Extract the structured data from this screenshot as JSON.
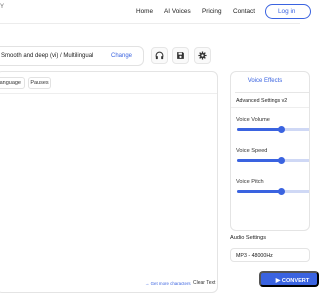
{
  "header": {
    "logo_fragment": "Y",
    "nav": [
      "Home",
      "AI Voices",
      "Pricing",
      "Contact"
    ],
    "login_label": "Log in"
  },
  "voice_bar": {
    "selected_voice": "Smooth and deep (vi) / Multilingual",
    "change_label": "Change",
    "icons": [
      "headphones-icon",
      "save-icon",
      "gear-icon"
    ]
  },
  "editor": {
    "tabs": [
      "anguage",
      "Pauses"
    ],
    "more_characters_label": "→ Get more characters",
    "clear_label": "Clear Text"
  },
  "voice_effects": {
    "tab_label": "Voice Effects",
    "advanced_label": "Advanced Settings v2",
    "sliders": [
      {
        "label": "Voice Volume",
        "level": 0.55
      },
      {
        "label": "Voice Speed",
        "level": 0.55
      },
      {
        "label": "Voice Pitch",
        "level": 0.55
      }
    ]
  },
  "audio_settings": {
    "label": "Audio Settings",
    "format": "MP3 - 48000Hz"
  },
  "convert": {
    "label": "CONVERT"
  },
  "colors": {
    "accent": "#3a63e0",
    "border": "#e4e4e4",
    "track": "#cfd8f5"
  }
}
